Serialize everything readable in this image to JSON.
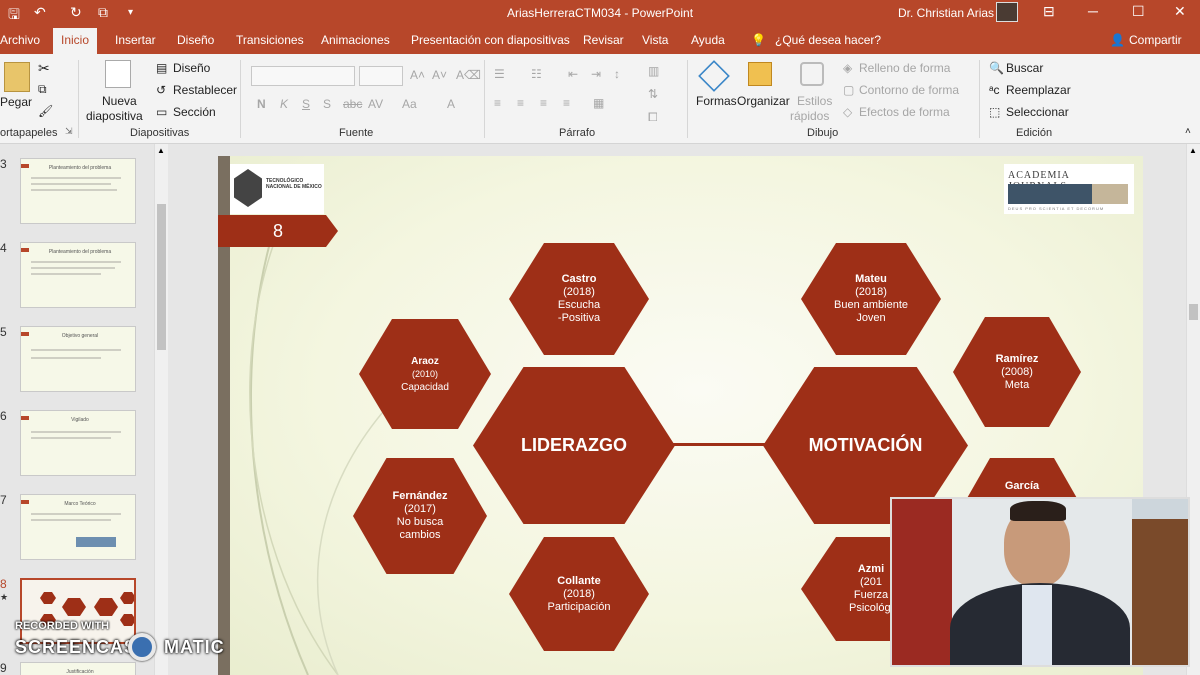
{
  "window": {
    "title": "AriasHerreraCTM034  -  PowerPoint",
    "user_name": "Dr. Christian Arias"
  },
  "tabs": [
    "Archivo",
    "Inicio",
    "Insertar",
    "Diseño",
    "Transiciones",
    "Animaciones",
    "Presentación con diapositivas",
    "Revisar",
    "Vista",
    "Ayuda"
  ],
  "tell_me": "¿Qué desea hacer?",
  "share": "Compartir",
  "ribbon": {
    "portapapeles": {
      "label": "ortapapeles",
      "pegar": "Pegar"
    },
    "diapositivas": {
      "label": "Diapositivas",
      "nueva1": "Nueva",
      "nueva2": "diapositiva",
      "diseno": "Diseño",
      "restablecer": "Restablecer",
      "seccion": "Sección"
    },
    "fuente": {
      "label": "Fuente",
      "n": "N",
      "k": "K",
      "s": "S",
      "s2": "S",
      "abc": "abc"
    },
    "parrafo": {
      "label": "Párrafo"
    },
    "dibujo": {
      "label": "Dibujo",
      "formas": "Formas",
      "organizar": "Organizar",
      "estilos1": "Estilos",
      "estilos2": "rápidos",
      "relleno": "Relleno de forma",
      "contorno": "Contorno de forma",
      "efectos": "Efectos de forma"
    },
    "edicion": {
      "label": "Edición",
      "buscar": "Buscar",
      "reemplazar": "Reemplazar",
      "seleccionar": "Seleccionar"
    }
  },
  "thumbnails": [
    {
      "num": "3",
      "title": "Planteamiento del problema"
    },
    {
      "num": "4",
      "title": "Planteamiento del problema"
    },
    {
      "num": "5",
      "title": "Objetivo general"
    },
    {
      "num": "6",
      "title": "Vigilado"
    },
    {
      "num": "7",
      "title": "Marco Teórico"
    },
    {
      "num": "8",
      "title": ""
    },
    {
      "num": "9",
      "title": "Justificación"
    }
  ],
  "slide": {
    "page_number": "8",
    "logo_left_text": "TECNOLÓGICO NACIONAL DE MÉXICO",
    "logo_right_text": "Academia Journals",
    "logo_right_sub": "DEUS PRO SCIENTIA ET DECORUM",
    "center_left": "LIDERAZGO",
    "center_right": "MOTIVACIÓN",
    "castro": {
      "name": "Castro",
      "year": "(2018)",
      "l1": "Escucha",
      "l2": "-Positiva"
    },
    "araoz": {
      "name": "Araoz",
      "year": "(2010)",
      "l1": "Capacidad"
    },
    "fernandez": {
      "name": "Fernández",
      "year": "(2017)",
      "l1": "No busca",
      "l2": "cambios"
    },
    "collante": {
      "name": "Collante",
      "year": "(2018)",
      "l1": "Participación"
    },
    "mateu": {
      "name": "Mateu",
      "year": "(2018)",
      "l1": "Buen ambiente",
      "l2": "Joven"
    },
    "ramirez": {
      "name": "Ramírez",
      "year": "(2008)",
      "l1": "Meta"
    },
    "garcia": {
      "name": "García"
    },
    "azmi": {
      "name": "Azmi",
      "year": "(201",
      "l1": "Fuerza",
      "l2": "Psicológi"
    }
  },
  "watermark": {
    "line1": "RECORDED WITH",
    "line2": "SCREENCAST",
    "line3": "MATIC"
  }
}
